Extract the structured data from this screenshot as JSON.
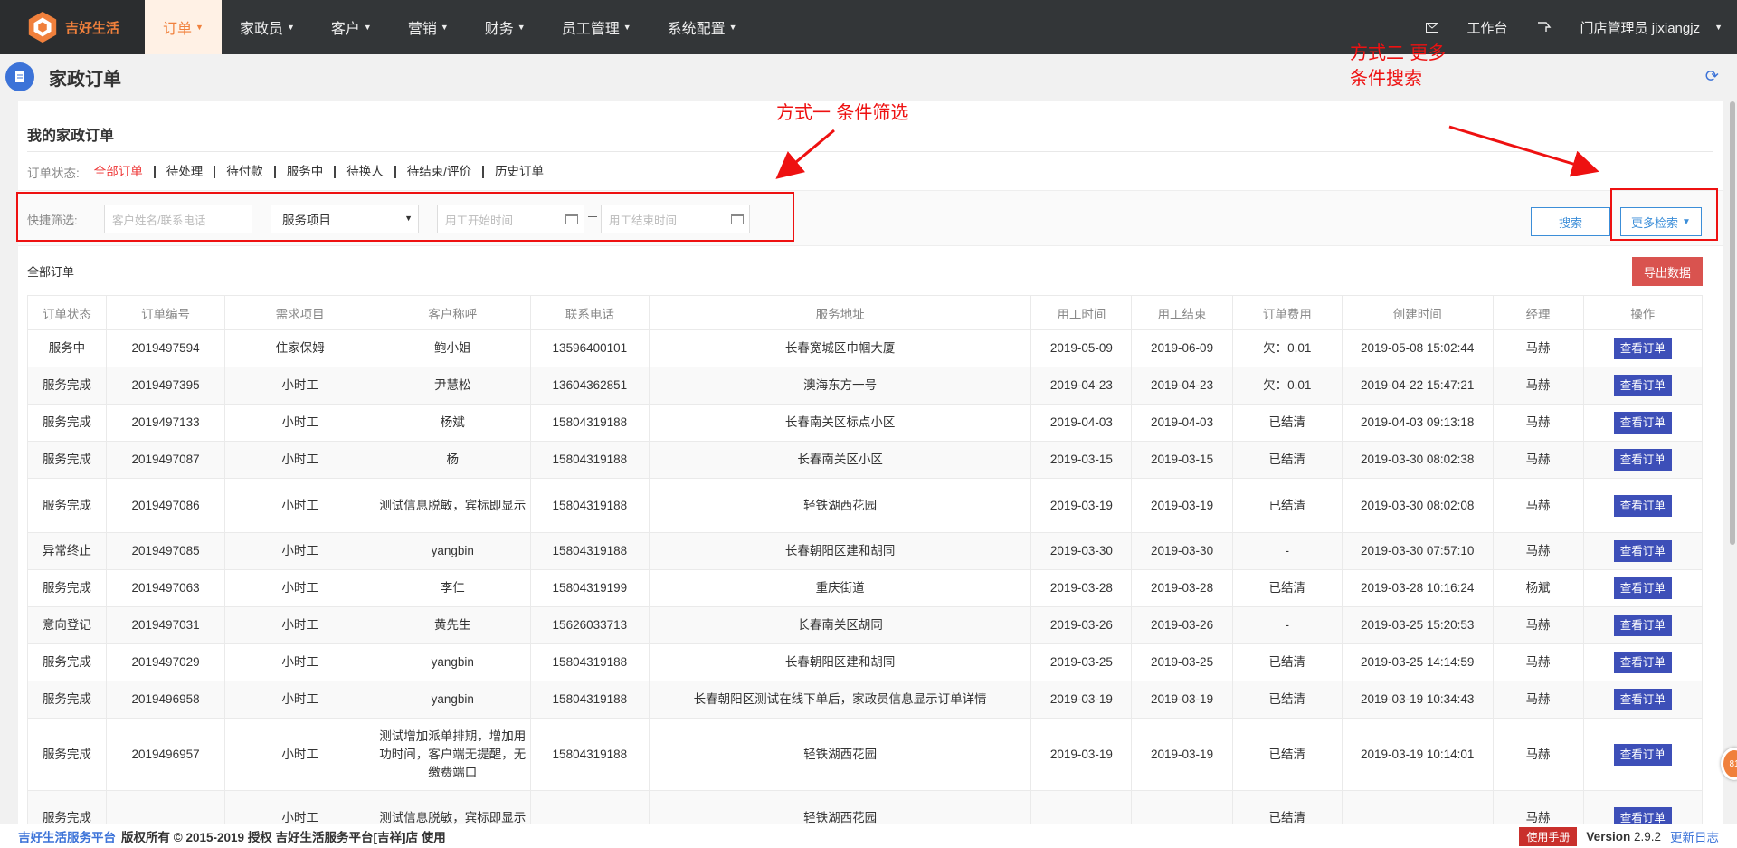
{
  "brand": {
    "name": "吉好生活"
  },
  "nav": {
    "items": [
      {
        "label": "订单",
        "active": true
      },
      {
        "label": "家政员"
      },
      {
        "label": "客户"
      },
      {
        "label": "营销"
      },
      {
        "label": "财务"
      },
      {
        "label": "员工管理"
      },
      {
        "label": "系统配置"
      }
    ],
    "workbench": "工作台",
    "user": "门店管理员  jixiangjz"
  },
  "page": {
    "title": "家政订单"
  },
  "panel": {
    "title": "我的家政订单",
    "status_label": "订单状态:",
    "status_items": [
      "全部订单",
      "待处理",
      "待付款",
      "服务中",
      "待换人",
      "待结束/评价",
      "历史订单"
    ],
    "filter_label": "快捷筛选:",
    "search_placeholder": "客户姓名/联系电话",
    "service_select": "服务项目",
    "start_placeholder": "用工开始时间",
    "end_placeholder": "用工结束时间",
    "search_btn": "搜索",
    "more_btn": "更多检索",
    "sub_title": "全部订单",
    "export_btn": "导出数据"
  },
  "annotations": {
    "one": "方式一 条件筛选",
    "two_line1": "方式二 更多",
    "two_line2": "条件搜索"
  },
  "table": {
    "headers": [
      "订单状态",
      "订单编号",
      "需求项目",
      "客户称呼",
      "联系电话",
      "服务地址",
      "用工时间",
      "用工结束",
      "订单费用",
      "创建时间",
      "经理",
      "操作"
    ],
    "view_label": "查看订单",
    "rows": [
      {
        "status": "服务中",
        "id": "2019497594",
        "item": "住家保姆",
        "name": "鲍小姐",
        "phone": "13596400101",
        "addr": "长春宽城区巾帼大厦",
        "start": "2019-05-09",
        "end": "2019-06-09",
        "fee": "欠：0.01",
        "created": "2019-05-08 15:02:44",
        "mgr": "马赫"
      },
      {
        "status": "服务完成",
        "id": "2019497395",
        "item": "小时工",
        "name": "尹慧松",
        "phone": "13604362851",
        "addr": "澳海东方一号",
        "start": "2019-04-23",
        "end": "2019-04-23",
        "fee": "欠：0.01",
        "created": "2019-04-22 15:47:21",
        "mgr": "马赫"
      },
      {
        "status": "服务完成",
        "id": "2019497133",
        "item": "小时工",
        "name": "杨斌",
        "phone": "15804319188",
        "addr": "长春南关区标点小区",
        "start": "2019-04-03",
        "end": "2019-04-03",
        "fee": "已结清",
        "created": "2019-04-03 09:13:18",
        "mgr": "马赫"
      },
      {
        "status": "服务完成",
        "id": "2019497087",
        "item": "小时工",
        "name": "杨",
        "phone": "15804319188",
        "addr": "长春南关区小区",
        "start": "2019-03-15",
        "end": "2019-03-15",
        "fee": "已结清",
        "created": "2019-03-30 08:02:38",
        "mgr": "马赫"
      },
      {
        "status": "服务完成",
        "id": "2019497086",
        "item": "小时工",
        "name": "测试信息脱敏，宾标即显示",
        "phone": "15804319188",
        "addr": "轻铁湖西花园",
        "start": "2019-03-19",
        "end": "2019-03-19",
        "fee": "已结清",
        "created": "2019-03-30 08:02:08",
        "mgr": "马赫"
      },
      {
        "status": "异常终止",
        "id": "2019497085",
        "item": "小时工",
        "name": "yangbin",
        "phone": "15804319188",
        "addr": "长春朝阳区建和胡同",
        "start": "2019-03-30",
        "end": "2019-03-30",
        "fee": "-",
        "created": "2019-03-30 07:57:10",
        "mgr": "马赫"
      },
      {
        "status": "服务完成",
        "id": "2019497063",
        "item": "小时工",
        "name": "李仁",
        "phone": "15804319199",
        "addr": "重庆街道",
        "start": "2019-03-28",
        "end": "2019-03-28",
        "fee": "已结清",
        "created": "2019-03-28 10:16:24",
        "mgr": "杨斌"
      },
      {
        "status": "意向登记",
        "id": "2019497031",
        "item": "小时工",
        "name": "黄先生",
        "phone": "15626033713",
        "addr": "长春南关区胡同",
        "start": "2019-03-26",
        "end": "2019-03-26",
        "fee": "-",
        "created": "2019-03-25 15:20:53",
        "mgr": "马赫"
      },
      {
        "status": "服务完成",
        "id": "2019497029",
        "item": "小时工",
        "name": "yangbin",
        "phone": "15804319188",
        "addr": "长春朝阳区建和胡同",
        "start": "2019-03-25",
        "end": "2019-03-25",
        "fee": "已结清",
        "created": "2019-03-25 14:14:59",
        "mgr": "马赫"
      },
      {
        "status": "服务完成",
        "id": "2019496958",
        "item": "小时工",
        "name": "yangbin",
        "phone": "15804319188",
        "addr": "长春朝阳区测试在线下单后，家政员信息显示订单详情",
        "start": "2019-03-19",
        "end": "2019-03-19",
        "fee": "已结清",
        "created": "2019-03-19 10:34:43",
        "mgr": "马赫"
      },
      {
        "status": "服务完成",
        "id": "2019496957",
        "item": "小时工",
        "name": "测试增加派单排期，增加用功时间，客户端无提醒，无缴费端口",
        "phone": "15804319188",
        "addr": "轻铁湖西花园",
        "start": "2019-03-19",
        "end": "2019-03-19",
        "fee": "已结清",
        "created": "2019-03-19 10:14:01",
        "mgr": "马赫"
      },
      {
        "status": "服务完成",
        "id": "",
        "item": "小时工",
        "name": "测试信息脱敏，宾标即显示",
        "phone": "",
        "addr": "轻铁湖西花园",
        "start": "",
        "end": "",
        "fee": "已结清",
        "created": "",
        "mgr": "马赫"
      }
    ]
  },
  "footer": {
    "brand": "吉好生活服务平台",
    "copy": "版权所有 © 2015-2019 授权 吉好生活服务平台[吉祥]店 使用",
    "manual": "使用手册",
    "version_label": "Version",
    "version": "2.9.2",
    "changelog": "更新日志"
  },
  "badge": "81",
  "colors": {
    "accent": "#f0803c",
    "primary": "#3c8ed8",
    "danger": "#e11",
    "nav_bg": "#333638"
  }
}
